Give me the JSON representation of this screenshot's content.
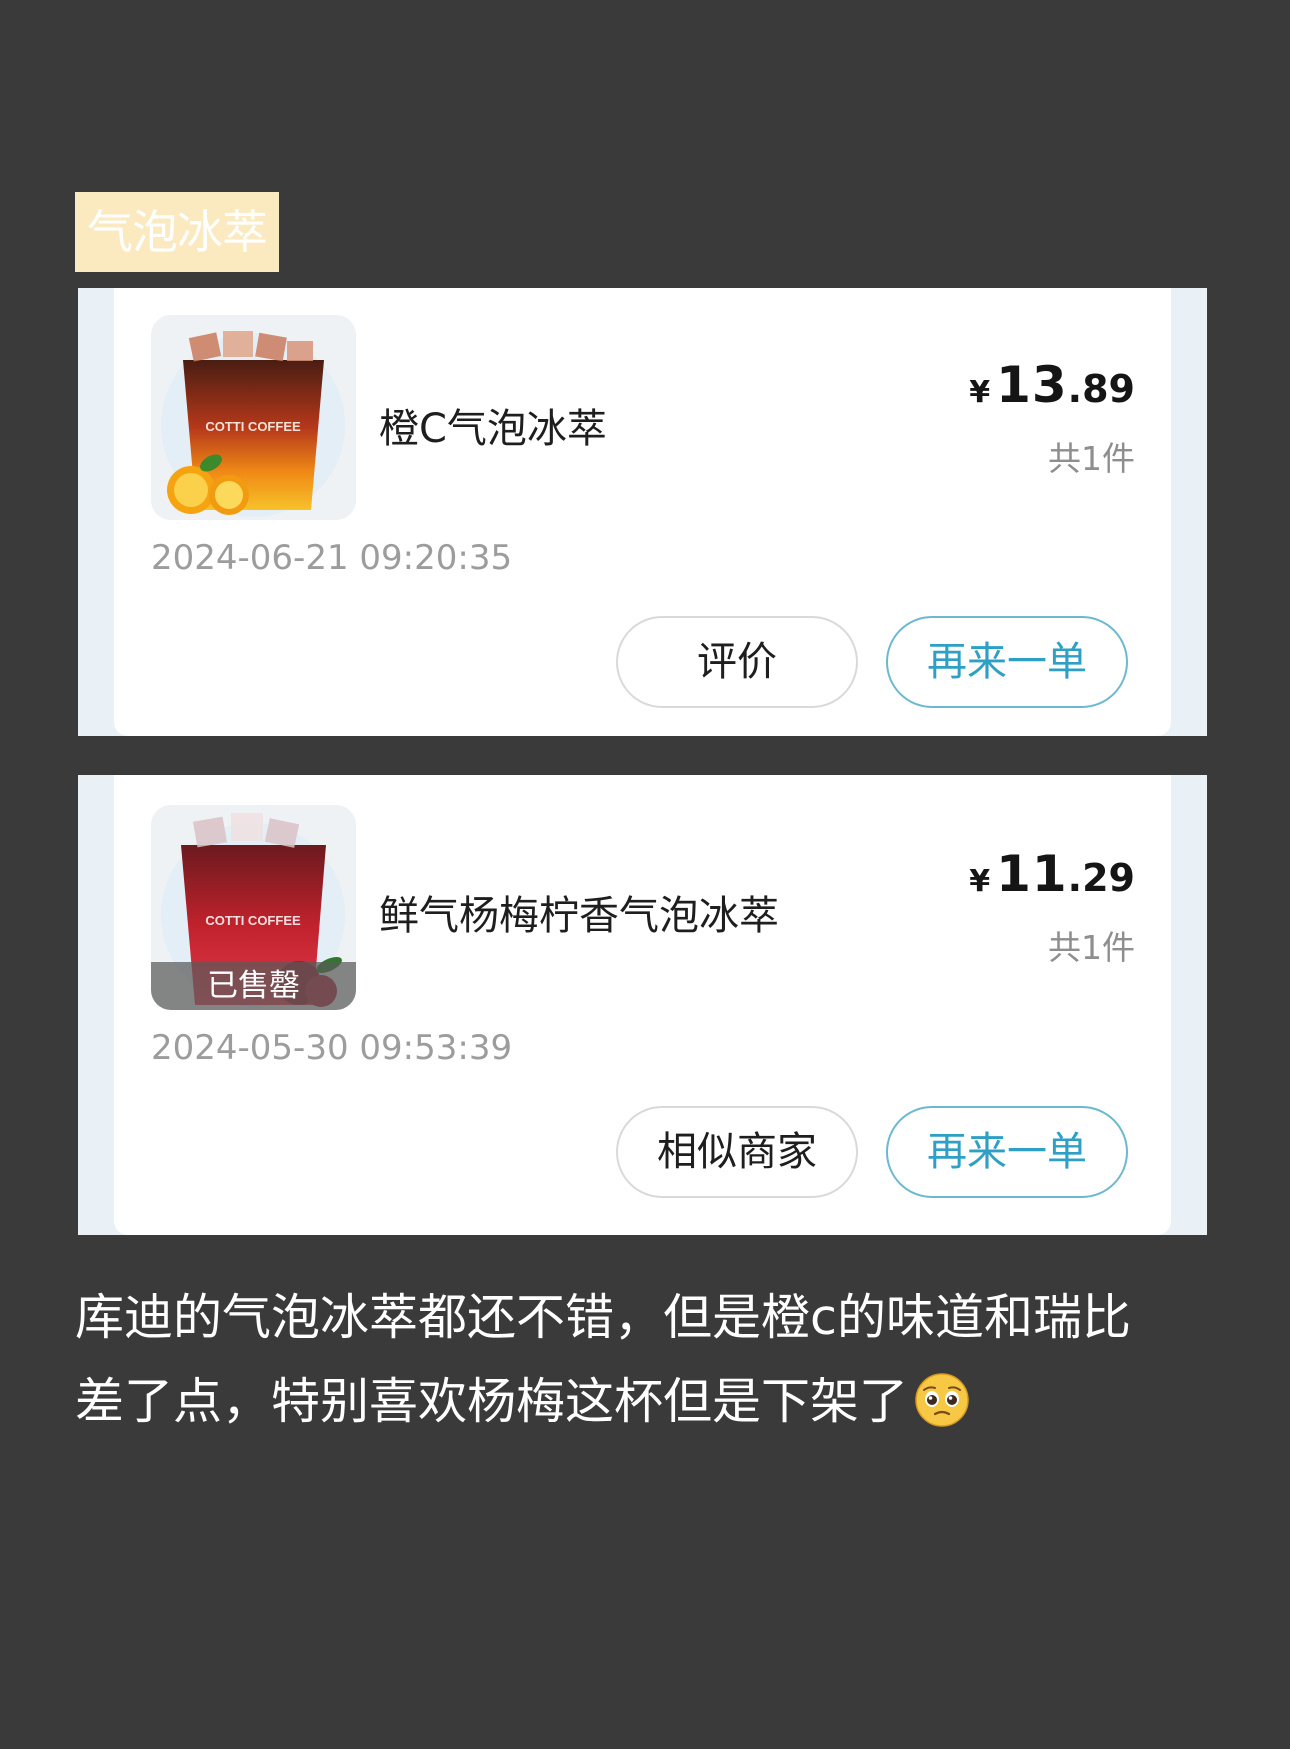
{
  "section_title": "气泡冰萃",
  "orders": [
    {
      "product_name": "橙C气泡冰萃",
      "image_brand_text": "COTTI COFFEE",
      "price_symbol": "¥",
      "price_int": "13",
      "price_dec": ".89",
      "quantity": "共1件",
      "datetime": "2024-06-21 09:20:35",
      "buttons": [
        "评价",
        "再来一单"
      ]
    },
    {
      "product_name": "鲜气杨梅柠香气泡冰萃",
      "image_brand_text": "COTTI COFFEE",
      "status_badge": "已售罄",
      "price_symbol": "¥",
      "price_int": "11",
      "price_dec": ".29",
      "quantity": "共1件",
      "datetime": "2024-05-30 09:53:39",
      "buttons": [
        "相似商家",
        "再来一单"
      ]
    }
  ],
  "comment": {
    "line1": "库迪的气泡冰萃都还不错，但是橙c的味道和瑞比",
    "line2": "差了点，特别喜欢杨梅这杯但是下架了",
    "emoji": "pleading-face-icon"
  },
  "colors": {
    "background": "#3a3a3a",
    "tag_bg": "#fbe9bf",
    "accent": "#2e9fc5",
    "card_frame": "#e9f1f6"
  }
}
